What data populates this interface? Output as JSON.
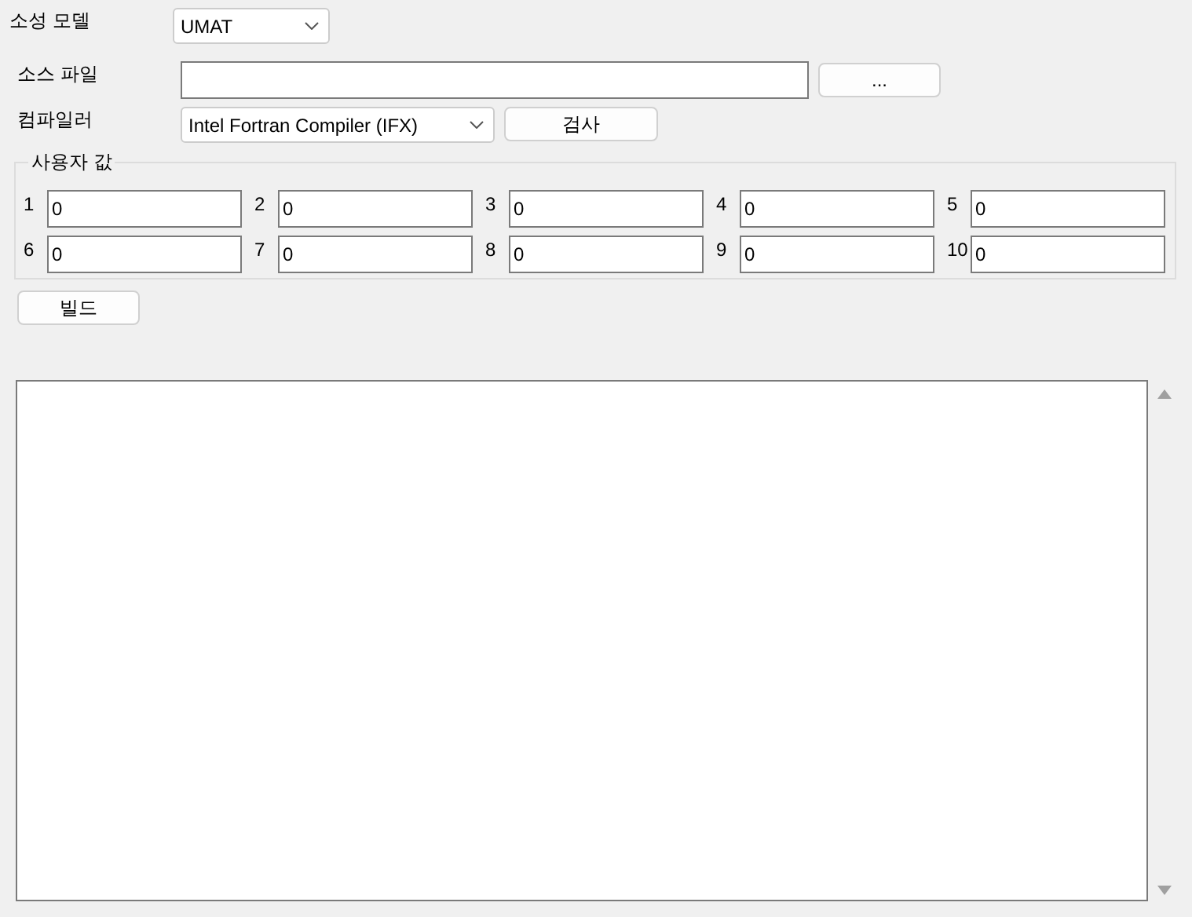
{
  "plastic_model": {
    "label": "소성 모델",
    "value": "UMAT"
  },
  "source_file": {
    "label": "소스 파일",
    "browse_button": "..."
  },
  "compiler": {
    "label": "컴파일러",
    "value": "Intel Fortran Compiler (IFX)",
    "check_button": "검사"
  },
  "user_values": {
    "title": "사용자 값",
    "items": [
      {
        "label": "1",
        "value": "0"
      },
      {
        "label": "2",
        "value": "0"
      },
      {
        "label": "3",
        "value": "0"
      },
      {
        "label": "4",
        "value": "0"
      },
      {
        "label": "5",
        "value": "0"
      },
      {
        "label": "6",
        "value": "0"
      },
      {
        "label": "7",
        "value": "0"
      },
      {
        "label": "8",
        "value": "0"
      },
      {
        "label": "9",
        "value": "0"
      },
      {
        "label": "10",
        "value": "0"
      }
    ]
  },
  "build_button": "빌드"
}
